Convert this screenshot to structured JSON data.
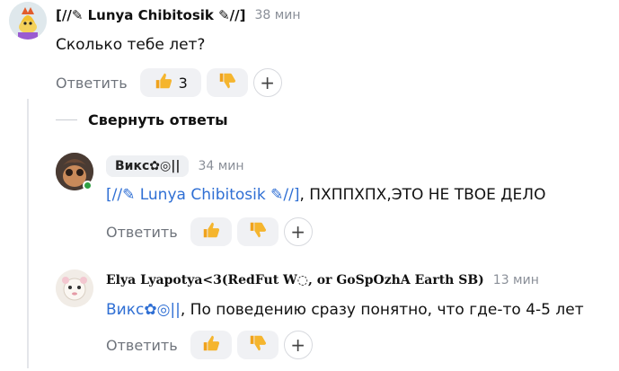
{
  "comments": [
    {
      "author": "[//✎ Lunya Chibitosik ✎//]",
      "time": "38 мин",
      "text": "Сколько тебе лет?",
      "reply_label": "Ответить",
      "like_count": "3"
    },
    {
      "author": "Викс✿◎||",
      "time": "34 мин",
      "mention": "[//✎ Lunya Chibitosik ✎//]",
      "text": ", ПХППХПХ,ЭТО НЕ ТВОЕ ДЕЛО",
      "reply_label": "Ответить"
    },
    {
      "author": "Elya Lyapotya<3(RedFut W◌, or GoSpOzhA Earth SB)",
      "time": "13 мин",
      "mention": "Викс✿◎||",
      "text": ", По поведению сразу понятно, что где-то 4-5 лет",
      "reply_label": "Ответить"
    }
  ],
  "collapse_label": "Свернуть ответы",
  "colors": {
    "mention": "#2f6fd4",
    "reaction_bg": "#f0f1f4",
    "online": "#2ea043"
  },
  "icons": {
    "like": "thumbs-up",
    "dislike": "thumbs-down",
    "add": "plus"
  }
}
